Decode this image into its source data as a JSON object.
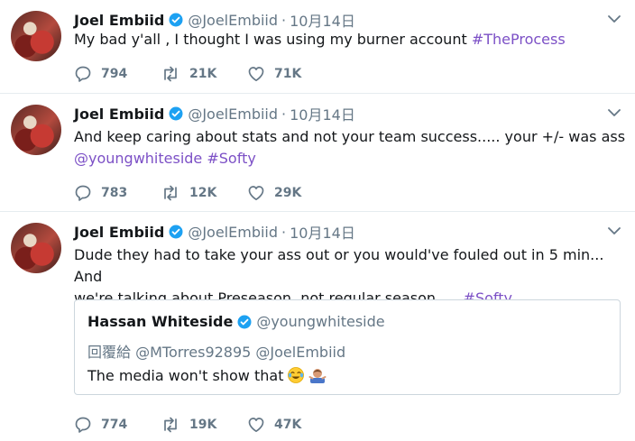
{
  "tweets": [
    {
      "name": "Joel Embiid",
      "handle": "@JoelEmbiid",
      "date": "10月14日",
      "text": "My bad y'all , I thought I was using my burner account ",
      "hashtag": "#TheProcess",
      "replies": "794",
      "retweets": "21K",
      "likes": "71K"
    },
    {
      "name": "Joel Embiid",
      "handle": "@JoelEmbiid",
      "date": "10月14日",
      "text": "And keep caring about stats and not your team success..... your +/- was ass",
      "mention": "@youngwhiteside",
      "hashtag": "#Softy",
      "replies": "783",
      "retweets": "12K",
      "likes": "29K"
    },
    {
      "name": "Joel Embiid",
      "handle": "@JoelEmbiid",
      "date": "10月14日",
      "text_line1": "Dude they had to take your ass out or you would've fouled out in 5 min... And",
      "text_line2": "we're talking about Preseason, not regular season..... ",
      "hashtag": "#Softy",
      "quote": {
        "name": "Hassan Whiteside",
        "handle": "@youngwhiteside",
        "reply_to": "回覆給 @MTorres92895 @JoelEmbiid",
        "text": "The media won't show that"
      },
      "replies": "774",
      "retweets": "19K",
      "likes": "47K"
    }
  ],
  "icons": {
    "verified": "verified-badge-icon",
    "reply": "reply-icon",
    "retweet": "retweet-icon",
    "like": "heart-icon",
    "chevron": "chevron-down-icon"
  },
  "colors": {
    "link": "#7c50c6",
    "verified": "#1da1f2",
    "secondary": "#657786",
    "text": "#14171a"
  }
}
